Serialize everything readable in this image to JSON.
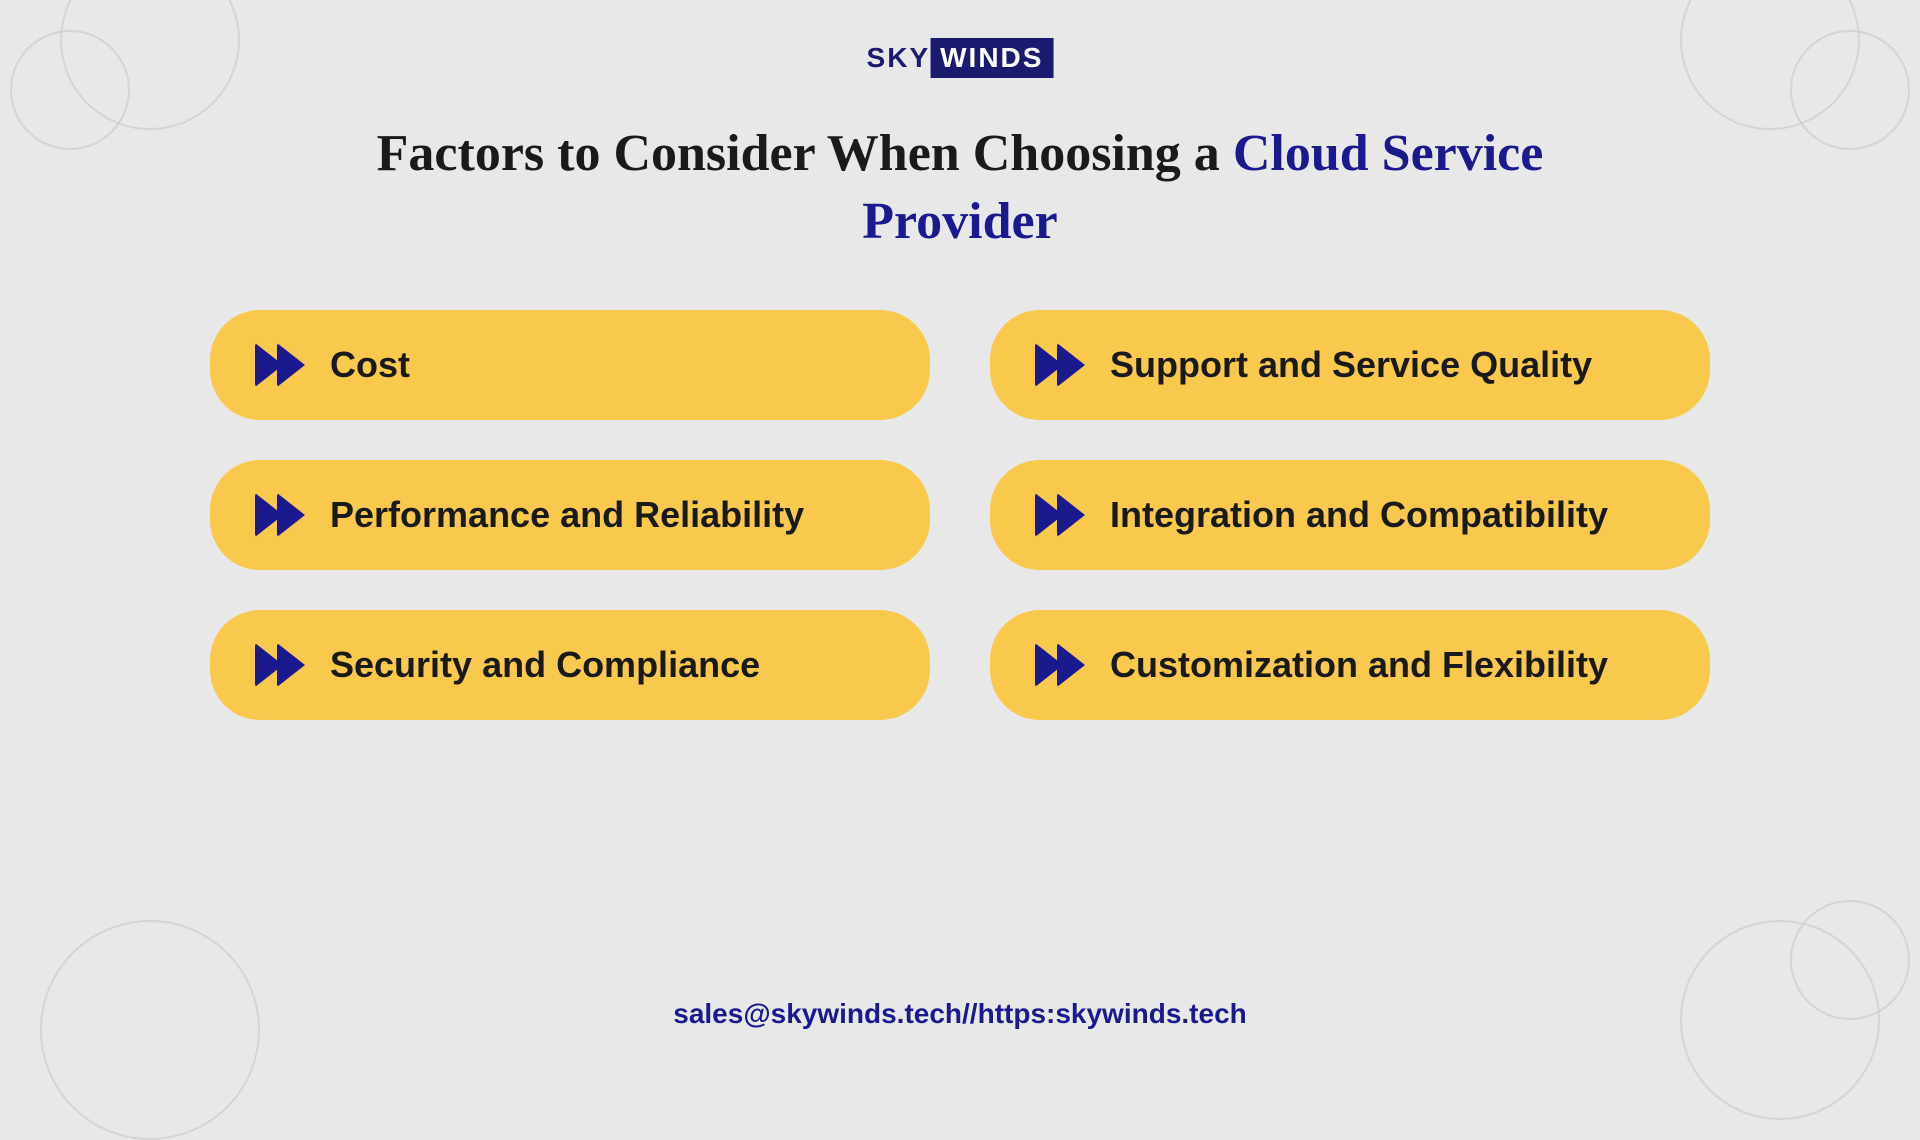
{
  "logo": {
    "sky": "SKY",
    "winds": "WINDS"
  },
  "title": {
    "part1": "Factors to Consider When Choosing a ",
    "highlight": "Cloud Service Provider"
  },
  "cards": [
    {
      "id": "cost",
      "label": "Cost"
    },
    {
      "id": "support",
      "label": "Support and Service Quality"
    },
    {
      "id": "performance",
      "label": "Performance and Reliability"
    },
    {
      "id": "integration",
      "label": "Integration and Compatibility"
    },
    {
      "id": "security",
      "label": "Security and Compliance"
    },
    {
      "id": "customization",
      "label": "Customization and Flexibility"
    }
  ],
  "footer": {
    "text": "sales@skywinds.tech//https:skywinds.tech"
  }
}
